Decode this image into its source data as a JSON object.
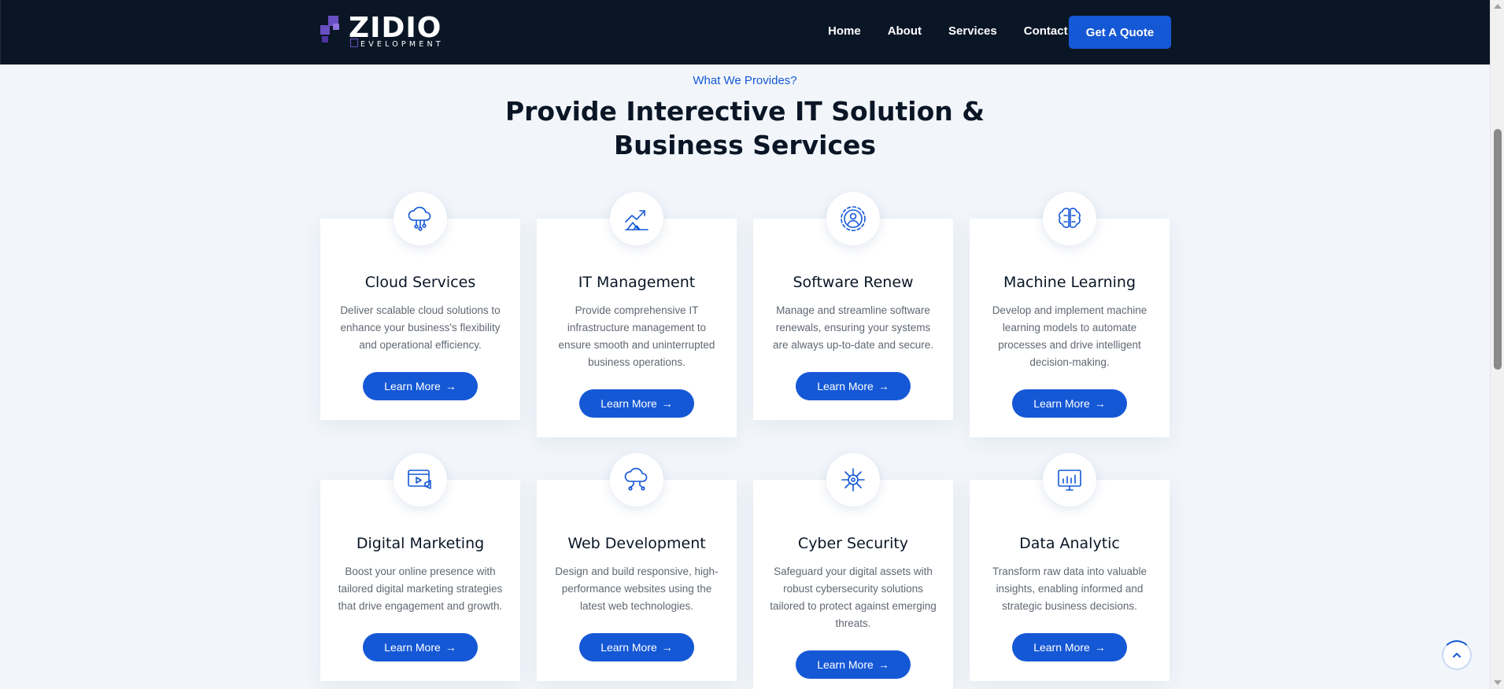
{
  "header": {
    "logo_word": "ZIDIO",
    "logo_sub": "EVELOPMENT",
    "nav": [
      "Home",
      "About",
      "Services",
      "Contact"
    ],
    "quote_label": "Get A Quote"
  },
  "section": {
    "eyebrow": "What We Provides?",
    "title_line1": "Provide Interective IT Solution &",
    "title_line2": "Business Services"
  },
  "cards": [
    {
      "icon": "cloud-network-icon",
      "title": "Cloud Services",
      "desc": "Deliver scalable cloud solutions to enhance your business's flexibility and operational efficiency.",
      "button": "Learn More"
    },
    {
      "icon": "growth-chart-icon",
      "title": "IT Management",
      "desc": "Provide comprehensive IT infrastructure management to ensure smooth and uninterrupted business operations.",
      "button": "Learn More"
    },
    {
      "icon": "gear-user-icon",
      "title": "Software Renew",
      "desc": "Manage and streamline software renewals, ensuring your systems are always up-to-date and secure.",
      "button": "Learn More"
    },
    {
      "icon": "brain-circuit-icon",
      "title": "Machine Learning",
      "desc": "Develop and implement machine learning models to automate processes and drive intelligent decision-making.",
      "button": "Learn More"
    },
    {
      "icon": "video-megaphone-icon",
      "title": "Digital Marketing",
      "desc": "Boost your online presence with tailored digital marketing strategies that drive engagement and growth.",
      "button": "Learn More"
    },
    {
      "icon": "cloud-code-icon",
      "title": "Web Development",
      "desc": "Design and build responsive, high-performance websites using the latest web technologies.",
      "button": "Learn More"
    },
    {
      "icon": "network-shield-icon",
      "title": "Cyber Security",
      "desc": "Safeguard your digital assets with robust cybersecurity solutions tailored to protect against emerging threats.",
      "button": "Learn More"
    },
    {
      "icon": "analytics-monitor-icon",
      "title": "Data Analytic",
      "desc": "Transform raw data into valuable insights, enabling informed and strategic business decisions.",
      "button": "Learn More"
    }
  ],
  "colors": {
    "header_bg": "#0a1626",
    "accent": "#1558d6",
    "title_text": "#0a1626",
    "body_text": "#606872",
    "page_bg": "#f2f6fb"
  }
}
